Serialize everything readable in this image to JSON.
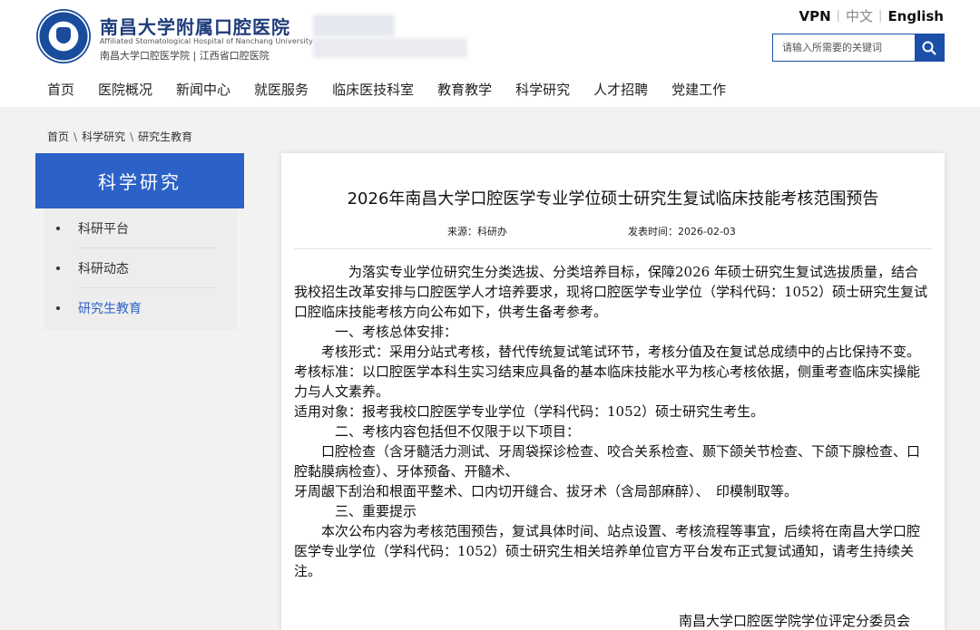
{
  "header": {
    "logo_cn": "南昌大学附属口腔医院",
    "logo_en": "Affiliated Stomatological Hospital of Nanchang University",
    "logo_sub": "南昌大学口腔医学院 | 江西省口腔医院",
    "lang_vpn": "VPN",
    "lang_zh": "中文",
    "lang_en": "English",
    "search_placeholder": "请输入所需要的关键词"
  },
  "nav": [
    "首页",
    "医院概况",
    "新闻中心",
    "就医服务",
    "临床医技科室",
    "教育教学",
    "科学研究",
    "人才招聘",
    "党建工作"
  ],
  "breadcrumb": [
    "首页",
    "科学研究",
    "研究生教育"
  ],
  "breadcrumb_sep": "\\",
  "sidebar": {
    "title": "科学研究",
    "items": [
      "科研平台",
      "科研动态",
      "研究生教育"
    ]
  },
  "article": {
    "title": "2026年南昌大学口腔医学专业学位硕士研究生复试临床技能考核范围预告",
    "source": "来源：科研办",
    "date": "发表时间：2026-02-03",
    "paragraphs": [
      "　　　　为落实专业学位研究生分类选拔、分类培养目标，保障2026 年硕士研究生复试选拔质量，结合我校招生改革安排与口腔医学人才培养要求，现将口腔医学专业学位（学科代码：1052）硕士研究生复试口腔临床技能考核方向公布如下，供考生备考参考。",
      "　　　一、考核总体安排：",
      "　　考核形式：采用分站式考核，替代传统复试笔试环节，考核分值及在复试总成绩中的占比保持不变。",
      "考核标准：以口腔医学本科生实习结束应具备的基本临床技能水平为核心考核依据，侧重考查临床实操能力与人文素养。",
      "适用对象：报考我校口腔医学专业学位（学科代码：1052）硕士研究生考生。",
      "　　　二、考核内容包括但不仅限于以下项目：",
      "　　口腔检查（含牙髓活力测试、牙周袋探诊检查、咬合关系检查、颞下颌关节检查、下颌下腺检查、口腔黏膜病检查）、牙体预备、开髓术、",
      "牙周龈下刮治和根面平整术、口内切开缝合、拔牙术（含局部麻醉）、　印模制取等。",
      "　　　三、重要提示",
      "　　本次公布内容为考核范围预告，复试具体时间、站点设置、考核流程等事宜，后续将在南昌大学口腔医学专业学位（学科代码：1052）硕士研究生相关培养单位官方平台发布正式复试通知，请考生持续关注。"
    ],
    "signature": "南昌大学口腔医学院学位评定分委员会"
  }
}
